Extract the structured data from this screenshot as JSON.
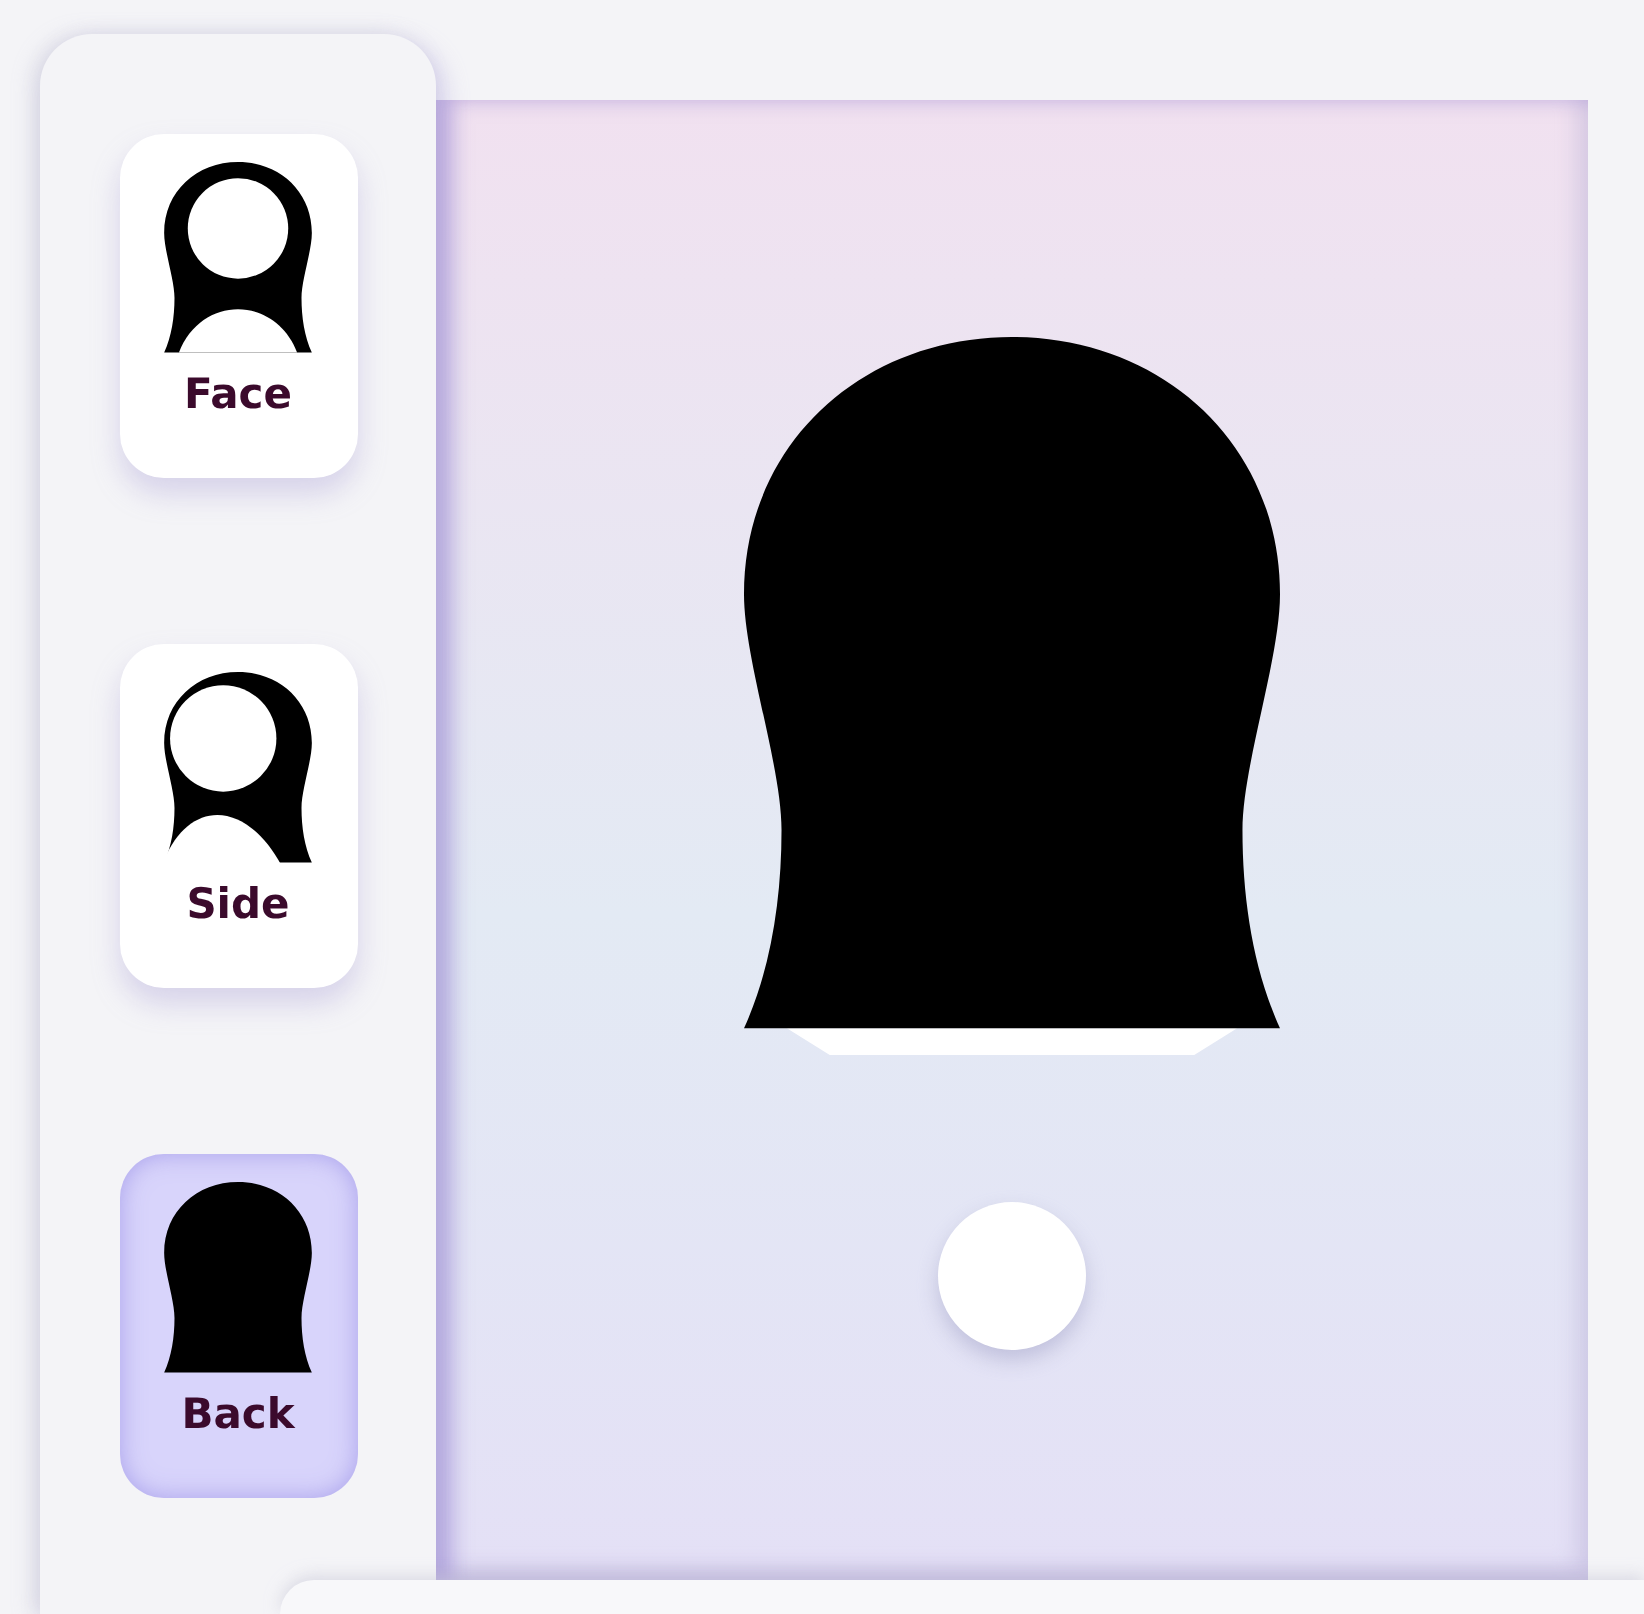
{
  "views": [
    {
      "kind": "face",
      "label": "Face",
      "selected": false
    },
    {
      "kind": "side",
      "label": "Side",
      "selected": false
    },
    {
      "kind": "back",
      "label": "Back",
      "selected": true
    }
  ]
}
